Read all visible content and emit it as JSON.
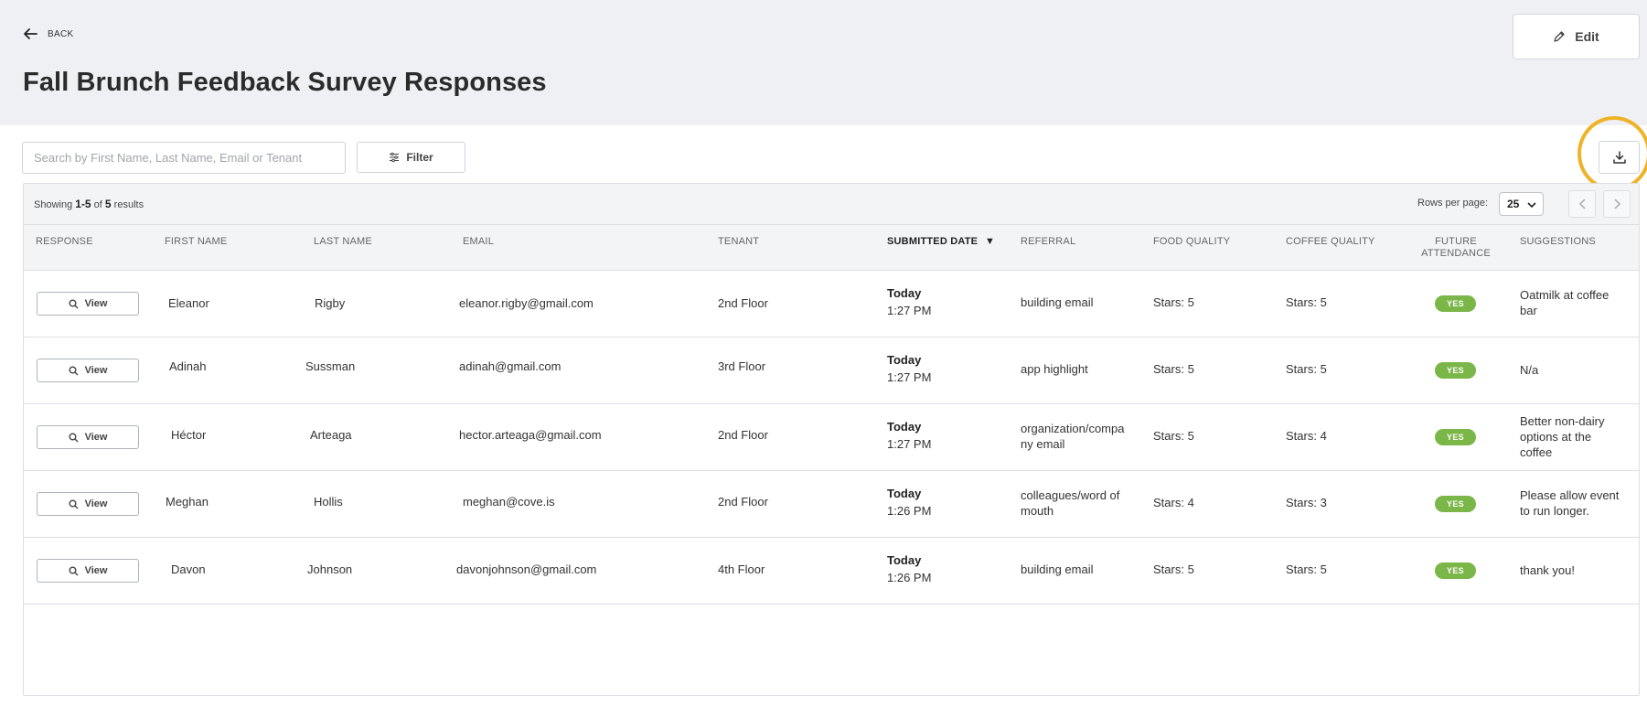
{
  "header": {
    "back_label": "BACK",
    "title": "Fall Brunch Feedback Survey Responses",
    "edit_label": "Edit"
  },
  "toolbar": {
    "search_placeholder": "Search by First Name, Last Name, Email or Tenant",
    "filter_label": "Filter",
    "download_icon": "download-icon"
  },
  "table": {
    "showing_prefix": "Showing",
    "showing_range": "1-5",
    "showing_of": "of",
    "showing_total": "5",
    "showing_suffix": "results",
    "rows_per_page_label": "Rows per page:",
    "rows_per_page_value": "25",
    "columns": {
      "response": "RESPONSE",
      "first_name": "FIRST NAME",
      "last_name": "LAST NAME",
      "email": "EMAIL",
      "tenant": "TENANT",
      "submitted_date": "SUBMITTED DATE",
      "referral": "REFERRAL",
      "food_quality": "FOOD QUALITY",
      "coffee_quality": "COFFEE QUALITY",
      "future_attendance": "FUTURE ATTENDANCE",
      "suggestions": "SUGGESTIONS"
    },
    "sort_indicator": "▼",
    "view_label": "View",
    "rows": [
      {
        "first": "Eleanor",
        "last": "Rigby",
        "email": "eleanor.rigby@gmail.com",
        "tenant": "2nd Floor",
        "day": "Today",
        "time": "1:27 PM",
        "referral": "building email",
        "food": "Stars: 5",
        "coffee": "Stars: 5",
        "attendance": "YES",
        "suggestion": "Oatmilk at coffee bar"
      },
      {
        "first": "Adinah",
        "last": "Sussman",
        "email": "adinah@gmail.com",
        "tenant": "3rd Floor",
        "day": "Today",
        "time": "1:27 PM",
        "referral": "app highlight",
        "food": "Stars: 5",
        "coffee": "Stars: 5",
        "attendance": "YES",
        "suggestion": "N/a"
      },
      {
        "first": "Héctor",
        "last": "Arteaga",
        "email": "hector.arteaga@gmail.com",
        "tenant": "2nd Floor",
        "day": "Today",
        "time": "1:27 PM",
        "referral": "organization/company email",
        "food": "Stars: 5",
        "coffee": "Stars: 4",
        "attendance": "YES",
        "suggestion": "Better non-dairy options at the coffee"
      },
      {
        "first": "Meghan",
        "last": "Hollis",
        "email": "meghan@cove.is",
        "tenant": "2nd Floor",
        "day": "Today",
        "time": "1:26 PM",
        "referral": "colleagues/word of mouth",
        "food": "Stars: 4",
        "coffee": "Stars: 3",
        "attendance": "YES",
        "suggestion": "Please allow event to run longer."
      },
      {
        "first": "Davon",
        "last": "Johnson",
        "email": "davonjohnson@gmail.com",
        "tenant": "4th Floor",
        "day": "Today",
        "time": "1:26 PM",
        "referral": "building email",
        "food": "Stars: 5",
        "coffee": "Stars: 5",
        "attendance": "YES",
        "suggestion": "thank you!"
      }
    ]
  },
  "colors": {
    "header_bg": "#eef0f4",
    "badge_green": "#7ab648",
    "highlight": "#eeb327"
  }
}
